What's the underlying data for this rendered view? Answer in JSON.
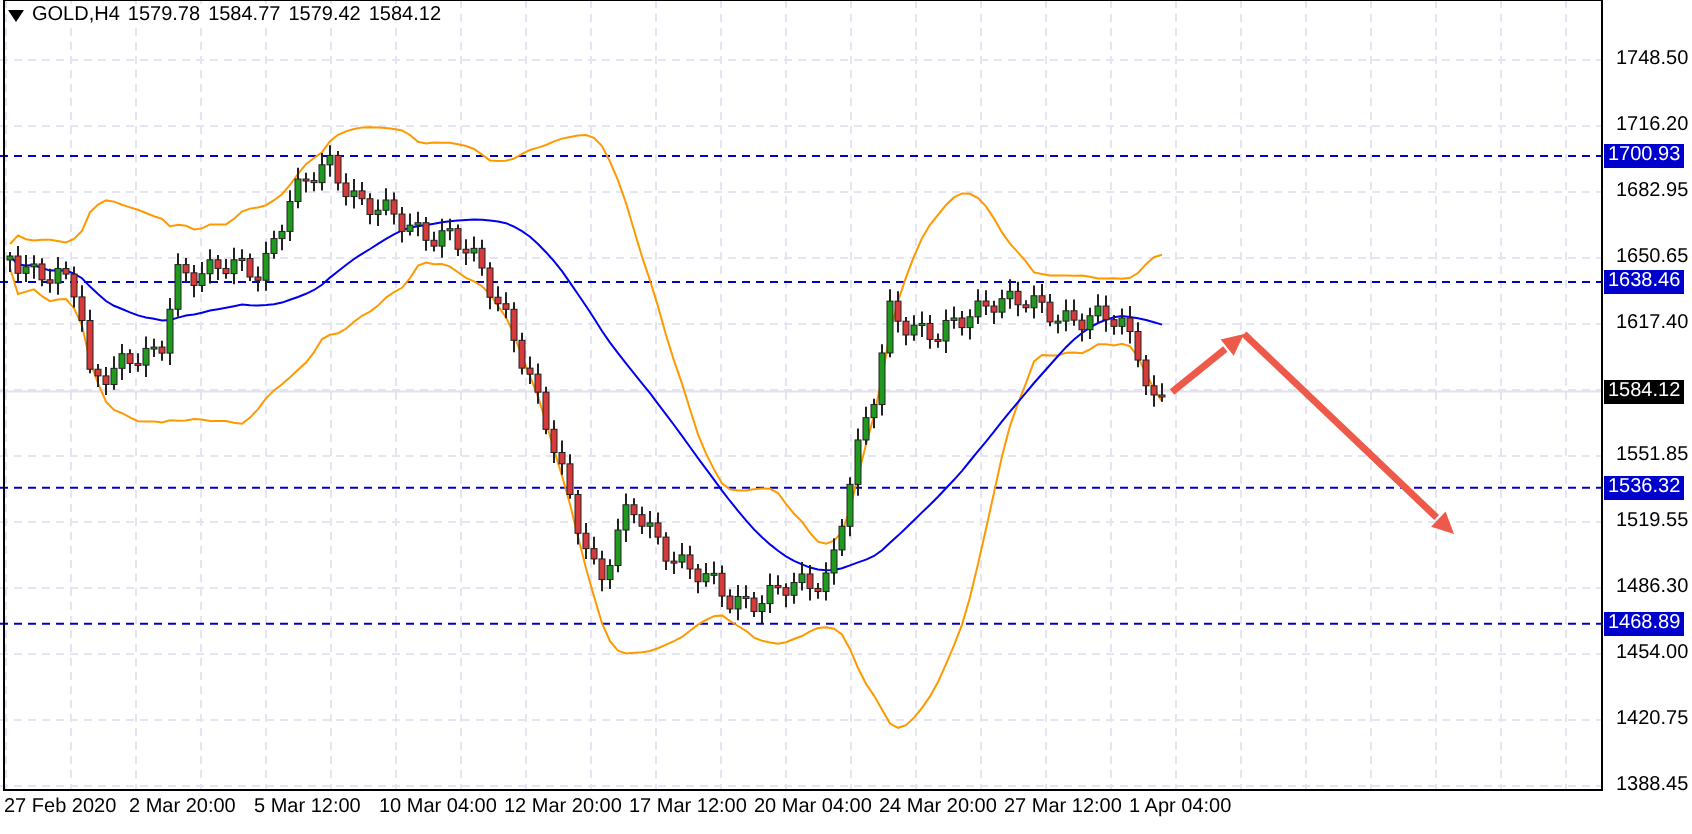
{
  "header": {
    "symbol": "GOLD,H4",
    "ohlc": [
      "1579.78",
      "1584.77",
      "1579.42",
      "1584.12"
    ]
  },
  "price_axis": {
    "ticks": [
      "1748.50",
      "1716.20",
      "1682.95",
      "1650.65",
      "1617.40",
      "1551.85",
      "1519.55",
      "1486.30",
      "1454.00",
      "1420.75",
      "1388.45"
    ],
    "current_price": "1584.12",
    "levels": [
      "1700.93",
      "1638.46",
      "1536.32",
      "1468.89"
    ]
  },
  "time_axis": {
    "labels": [
      "27 Feb 2020",
      "2 Mar 20:00",
      "5 Mar 12:00",
      "10 Mar 04:00",
      "12 Mar 20:00",
      "17 Mar 12:00",
      "20 Mar 04:00",
      "24 Mar 20:00",
      "27 Mar 12:00",
      "1 Apr 04:00"
    ]
  }
}
